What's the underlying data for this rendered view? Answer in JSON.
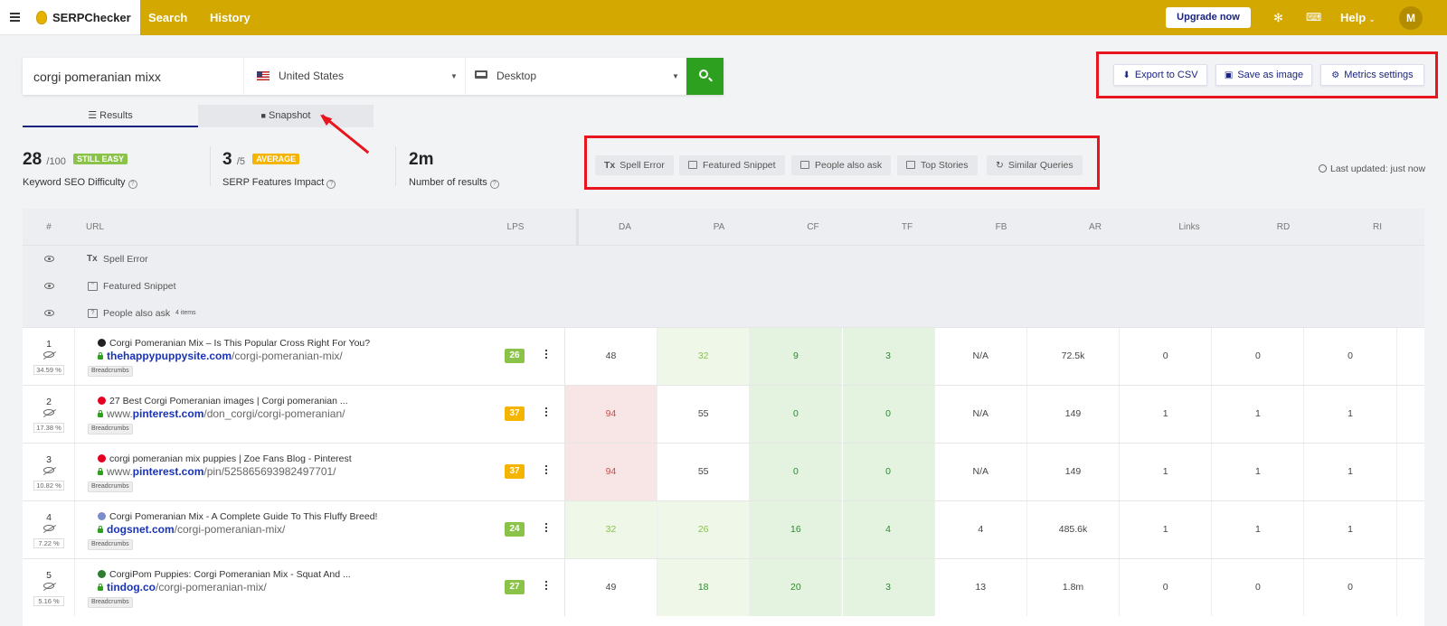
{
  "app": {
    "brand": "SERPChecker",
    "nav": [
      "Search",
      "History"
    ],
    "upgrade_label": "Upgrade now",
    "help_label": "Help",
    "avatar_initial": "M"
  },
  "search": {
    "keyword": "corgi pomeranian mixx",
    "country": "United States",
    "device": "Desktop"
  },
  "tabs": [
    {
      "label": "Results",
      "active": true
    },
    {
      "label": "Snapshot",
      "active": false
    }
  ],
  "actions": {
    "export_csv": "Export to CSV",
    "save_image": "Save as image",
    "metrics_settings": "Metrics settings"
  },
  "stats": {
    "kd_value": "28",
    "kd_max": "/100",
    "kd_badge": "STILL EASY",
    "kd_label": "Keyword SEO Difficulty",
    "sfi_value": "3",
    "sfi_max": "/5",
    "sfi_badge": "AVERAGE",
    "sfi_label": "SERP Features Impact",
    "results_value": "2m",
    "results_label": "Number of results"
  },
  "serp_features": [
    "Spell Error",
    "Featured Snippet",
    "People also ask",
    "Top Stories",
    "Similar Queries"
  ],
  "last_updated": "Last updated: just now",
  "colors": {
    "brand_yellow": "#d3a800",
    "search_green": "#2ea01f",
    "badge_green": "#8bc34a",
    "badge_orange": "#f5b400",
    "annotation_red": "#e8141e",
    "link_blue": "#1a33b8"
  },
  "table": {
    "headers": [
      "#",
      "URL",
      "LPS",
      "DA",
      "PA",
      "CF",
      "TF",
      "FB",
      "AR",
      "Links",
      "RD",
      "RI"
    ],
    "feature_rows": [
      {
        "label": "Spell Error",
        "icon": "spell-error-icon",
        "extra": ""
      },
      {
        "label": "Featured Snippet",
        "icon": "featured-snippet-icon",
        "extra": ""
      },
      {
        "label": "People also ask",
        "icon": "people-also-ask-icon",
        "extra": "4 items"
      }
    ],
    "rows": [
      {
        "rank": "1",
        "pct": "34.59 %",
        "title": "Corgi Pomeranian Mix – Is This Popular Cross Right For You?",
        "domain_prefix": "",
        "domain": "thehappypuppysite.com",
        "path": "/corgi-pomeranian-mix/",
        "crumb": "Breadcrumbs",
        "lps": "26",
        "da": "48",
        "pa": "32",
        "cf": "9",
        "tf": "3",
        "fb": "N/A",
        "ar": "72.5k",
        "links": "0",
        "rd": "0",
        "ri": "0"
      },
      {
        "rank": "2",
        "pct": "17.38 %",
        "title": "27 Best Corgi Pomeranian images | Corgi pomeranian ...",
        "domain_prefix": "www.",
        "domain": "pinterest.com",
        "path": "/don_corgi/corgi-pomeranian/",
        "crumb": "Breadcrumbs",
        "lps": "37",
        "da": "94",
        "pa": "55",
        "cf": "0",
        "tf": "0",
        "fb": "N/A",
        "ar": "149",
        "links": "1",
        "rd": "1",
        "ri": "1"
      },
      {
        "rank": "3",
        "pct": "10.82 %",
        "title": "corgi pomeranian mix puppies | Zoe Fans Blog - Pinterest",
        "domain_prefix": "www.",
        "domain": "pinterest.com",
        "path": "/pin/525865693982497701/",
        "crumb": "Breadcrumbs",
        "lps": "37",
        "da": "94",
        "pa": "55",
        "cf": "0",
        "tf": "0",
        "fb": "N/A",
        "ar": "149",
        "links": "1",
        "rd": "1",
        "ri": "1"
      },
      {
        "rank": "4",
        "pct": "7.22 %",
        "title": "Corgi Pomeranian Mix - A Complete Guide To This Fluffy Breed!",
        "domain_prefix": "",
        "domain": "dogsnet.com",
        "path": "/corgi-pomeranian-mix/",
        "crumb": "Breadcrumbs",
        "lps": "24",
        "da": "32",
        "pa": "26",
        "cf": "16",
        "tf": "4",
        "fb": "4",
        "ar": "485.6k",
        "links": "1",
        "rd": "1",
        "ri": "1"
      },
      {
        "rank": "5",
        "pct": "5.16 %",
        "title": "CorgiPom Puppies: Corgi Pomeranian Mix - Squat And ...",
        "domain_prefix": "",
        "domain": "tindog.co",
        "path": "/corgi-pomeranian-mix/",
        "crumb": "Breadcrumbs",
        "lps": "27",
        "da": "49",
        "pa": "18",
        "cf": "20",
        "tf": "3",
        "fb": "13",
        "ar": "1.8m",
        "links": "0",
        "rd": "0",
        "ri": "0"
      }
    ]
  }
}
